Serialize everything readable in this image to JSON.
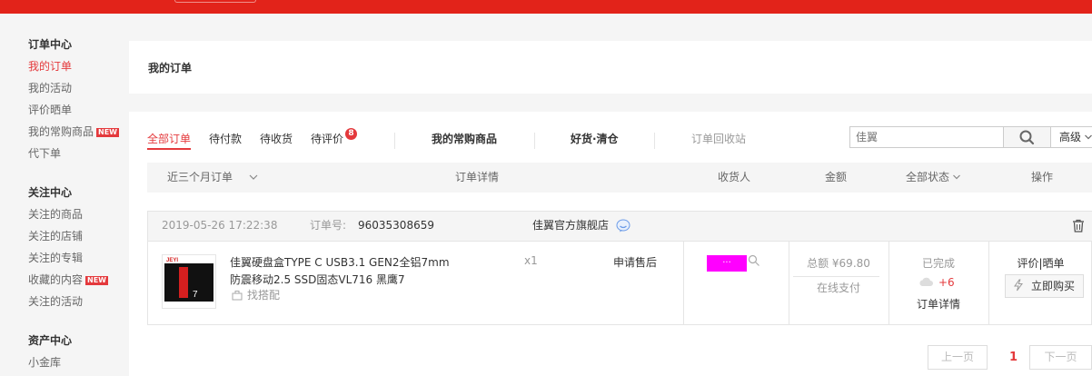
{
  "sidebar": {
    "groups": [
      {
        "title": "订单中心",
        "items": [
          "我的订单",
          "我的活动",
          "评价晒单",
          "我的常购商品",
          "代下单"
        ]
      },
      {
        "title": "关注中心",
        "items": [
          "关注的商品",
          "关注的店铺",
          "关注的专辑",
          "收藏的内容",
          "关注的活动"
        ]
      },
      {
        "title": "资产中心",
        "items": [
          "小金库"
        ]
      }
    ],
    "new_badge": "NEW"
  },
  "page_title": "我的订单",
  "tabs": {
    "all": "全部订单",
    "pending_pay": "待付款",
    "pending_receive": "待收货",
    "pending_review": "待评价",
    "pending_review_count": "8",
    "frequent": "我的常购商品",
    "good_clearance": "好货·清仓",
    "recycle": "订单回收站"
  },
  "search": {
    "placeholder": "佳翼",
    "advanced": "高级"
  },
  "table_header": {
    "range": "近三个月订单",
    "detail": "订单详情",
    "receiver": "收货人",
    "amount": "金额",
    "status": "全部状态",
    "action": "操作"
  },
  "order": {
    "datetime": "2019-05-26 17:22:38",
    "number_label": "订单号:",
    "number": "96035308659",
    "shop": "佳翼官方旗舰店",
    "product_name": "佳翼硬盘盒TYPE C USB3.1 GEN2全铝7mm防震移动2.5 SSD固态VL716 黑鹰7",
    "image_brand": "JEYI",
    "image_model": "7",
    "match_label": "找搭配",
    "qty": "x1",
    "after_sale": "申请售后",
    "receiver": "···",
    "total": "总额 ¥69.80",
    "pay_type": "在线支付",
    "status": "已完成",
    "points": "+6",
    "detail_link": "订单详情",
    "review": "评价|晒单",
    "buy_again": "立即购买"
  },
  "pagination": {
    "prev": "上一页",
    "current": "1",
    "next": "下一页"
  },
  "colors": {
    "brand_red": "#e2231a",
    "accent_red": "#e4393c",
    "receiver_mask": "#ff00ff"
  }
}
